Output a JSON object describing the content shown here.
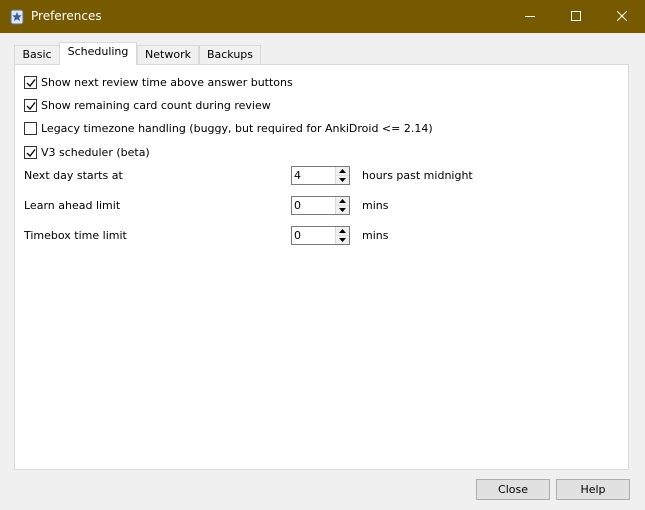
{
  "window": {
    "title": "Preferences",
    "accent_color": "#775900",
    "icons": {
      "app": "anki-app-icon",
      "minimize": "minimize-icon",
      "maximize": "maximize-icon",
      "close": "close-icon"
    }
  },
  "tabs": [
    {
      "label": "Basic",
      "active": false
    },
    {
      "label": "Scheduling",
      "active": true
    },
    {
      "label": "Network",
      "active": false
    },
    {
      "label": "Backups",
      "active": false
    }
  ],
  "scheduling": {
    "options": [
      {
        "label": "Show next review time above answer buttons",
        "checked": true
      },
      {
        "label": "Show remaining card count during review",
        "checked": true
      },
      {
        "label": "Legacy timezone handling (buggy, but required for AnkiDroid <= 2.14)",
        "checked": false
      },
      {
        "label": "V3 scheduler (beta)",
        "checked": true
      }
    ],
    "fields": [
      {
        "label": "Next day starts at",
        "value": "4",
        "suffix": "hours past midnight"
      },
      {
        "label": "Learn ahead limit",
        "value": "0",
        "suffix": "mins"
      },
      {
        "label": "Timebox time limit",
        "value": "0",
        "suffix": "mins"
      }
    ]
  },
  "buttons": {
    "close": "Close",
    "help": "Help"
  }
}
